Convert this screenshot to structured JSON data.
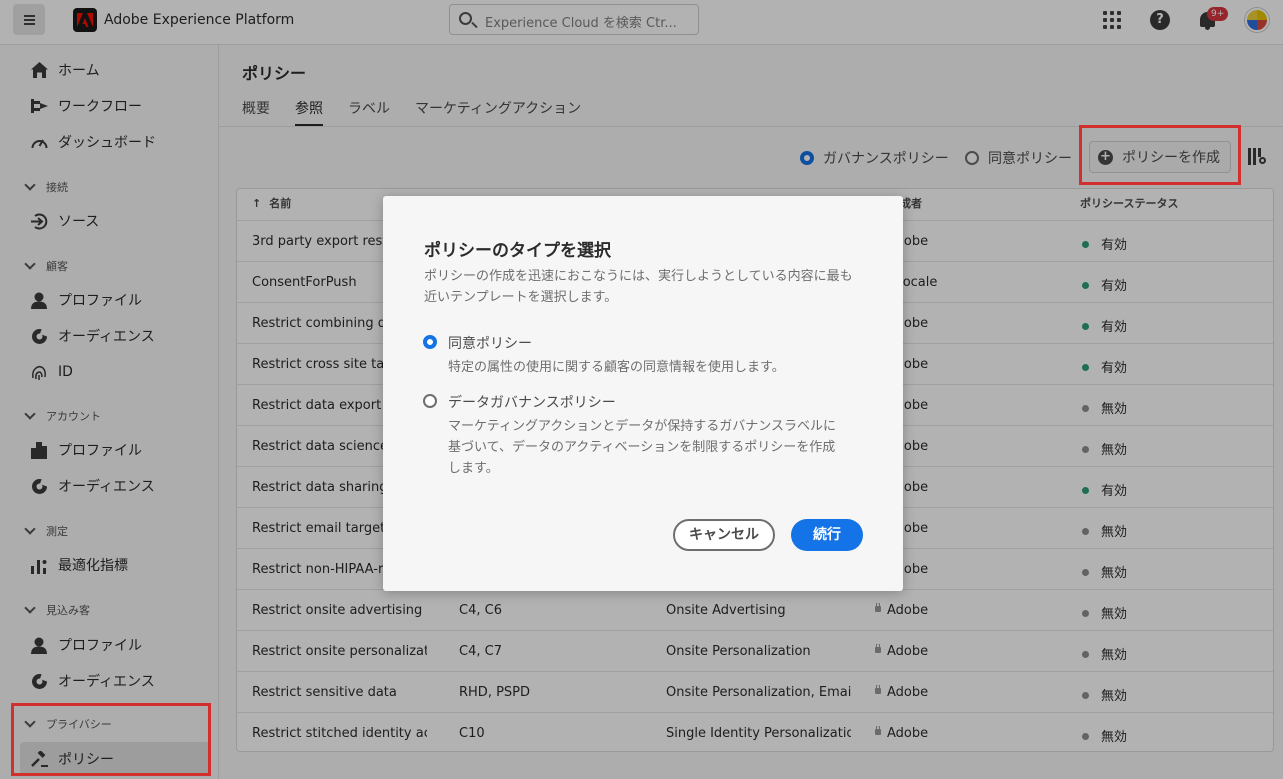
{
  "app": {
    "title": "Adobe Experience Platform",
    "search_placeholder": "Experience Cloud を検索 Ctr...",
    "notification_badge": "9+"
  },
  "sidebar": {
    "top_items": [
      {
        "label": "ホーム",
        "icon": "home-icon"
      },
      {
        "label": "ワークフロー",
        "icon": "workflow-icon"
      },
      {
        "label": "ダッシュボード",
        "icon": "dashboard-icon"
      }
    ],
    "sections": [
      {
        "title": "接続",
        "items": [
          {
            "label": "ソース",
            "icon": "source-icon"
          }
        ]
      },
      {
        "title": "顧客",
        "items": [
          {
            "label": "プロファイル",
            "icon": "user-icon"
          },
          {
            "label": "オーディエンス",
            "icon": "audience-icon"
          },
          {
            "label": "ID",
            "icon": "fingerprint-icon"
          }
        ]
      },
      {
        "title": "アカウント",
        "items": [
          {
            "label": "プロファイル",
            "icon": "building-icon"
          },
          {
            "label": "オーディエンス",
            "icon": "audience-icon"
          }
        ]
      },
      {
        "title": "測定",
        "items": [
          {
            "label": "最適化指標",
            "icon": "metrics-icon"
          }
        ]
      },
      {
        "title": "見込み客",
        "items": [
          {
            "label": "プロファイル",
            "icon": "user-icon"
          },
          {
            "label": "オーディエンス",
            "icon": "audience-icon"
          }
        ]
      },
      {
        "title": "プライバシー",
        "items": [
          {
            "label": "ポリシー",
            "icon": "gavel-icon"
          }
        ]
      }
    ]
  },
  "main": {
    "title": "ポリシー",
    "tabs": [
      "概要",
      "参照",
      "ラベル",
      "マーケティングアクション"
    ],
    "active_tab": "参照",
    "filter": {
      "governance": "ガバナンスポリシー",
      "consent": "同意ポリシー",
      "selected": "ガバナンスポリシー"
    },
    "create_button": "ポリシーを作成",
    "columns": {
      "name": "名前",
      "creator": "成者",
      "status": "ポリシーステータス"
    },
    "rows": [
      {
        "name": "3rd party export restric",
        "labels": "",
        "actions": "",
        "creator": "Adobe",
        "status": "有効",
        "active": true
      },
      {
        "name": "ConsentForPush",
        "labels": "",
        "actions": "",
        "creator": "o locale",
        "status": "有効",
        "active": true
      },
      {
        "name": "Restrict combining dire",
        "labels": "",
        "actions": "",
        "creator": "Adobe",
        "status": "有効",
        "active": true
      },
      {
        "name": "Restrict cross site targe",
        "labels": "",
        "actions": "",
        "creator": "Adobe",
        "status": "有効",
        "active": true
      },
      {
        "name": "Restrict data export",
        "labels": "",
        "actions": "",
        "creator": "Adobe",
        "status": "無効",
        "active": false
      },
      {
        "name": "Restrict data science",
        "labels": "",
        "actions": "",
        "creator": "Adobe",
        "status": "無効",
        "active": false
      },
      {
        "name": "Restrict data sharing",
        "labels": "",
        "actions": "",
        "creator": "Adobe",
        "status": "有効",
        "active": true
      },
      {
        "name": "Restrict email targeting",
        "labels": "",
        "actions": "",
        "creator": "Adobe",
        "status": "無効",
        "active": false
      },
      {
        "name": "Restrict non-HIPAA-rea",
        "labels": "",
        "actions": "",
        "creator": "Adobe",
        "status": "無効",
        "active": false
      },
      {
        "name": "Restrict onsite advertising",
        "labels": "C4, C6",
        "actions": "Onsite Advertising",
        "creator": "Adobe",
        "status": "無効",
        "active": false
      },
      {
        "name": "Restrict onsite personalization",
        "labels": "C4, C7",
        "actions": "Onsite Personalization",
        "creator": "Adobe",
        "status": "無効",
        "active": false
      },
      {
        "name": "Restrict sensitive data",
        "labels": "RHD, PSPD",
        "actions": "Onsite Personalization, Email...",
        "creator": "Adobe",
        "status": "無効",
        "active": false
      },
      {
        "name": "Restrict stitched identity acti...",
        "labels": "C10",
        "actions": "Single Identity Personalization",
        "creator": "Adobe",
        "status": "無効",
        "active": false
      }
    ]
  },
  "dialog": {
    "title": "ポリシーのタイプを選択",
    "description": "ポリシーの作成を迅速におこなうには、実行しようとしている内容に最も近いテンプレートを選択します。",
    "options": [
      {
        "label": "同意ポリシー",
        "description": "特定の属性の使用に関する顧客の同意情報を使用します。"
      },
      {
        "label": "データガバナンスポリシー",
        "description": "マーケティングアクションとデータが保持するガバナンスラベルに基づいて、データのアクティベーションを制限するポリシーを作成します。"
      }
    ],
    "cancel": "キャンセル",
    "continue": "続行"
  },
  "colors": {
    "accent": "#1473e6",
    "active_status": "#2d9d78",
    "inactive_status": "#8e8e8e",
    "highlight_box": "#d32f2f"
  }
}
